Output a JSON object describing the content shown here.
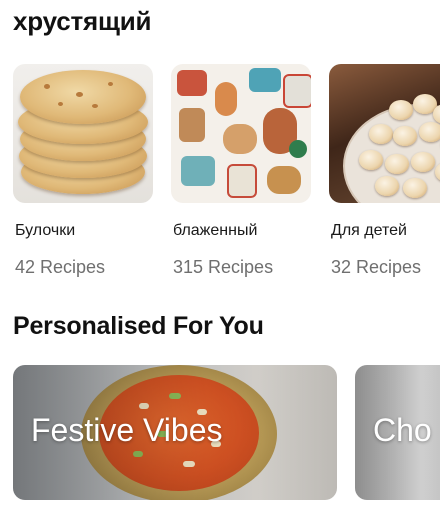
{
  "sections": {
    "top_title": "хрустящий",
    "personalised_title": "Personalised For You"
  },
  "categories": [
    {
      "title": "Булочки",
      "count": "42 Recipes",
      "image": "stacked-cookies-photo"
    },
    {
      "title": "блаженный",
      "count": "315 Recipes",
      "image": "gingerbread-cookies-photo"
    },
    {
      "title": "Для детей",
      "count": "32 Recipes",
      "image": "cookie-plate-photo"
    }
  ],
  "personalised": [
    {
      "label": "Festive Vibes",
      "image": "halwa-bowl-photo"
    },
    {
      "label": "Cho",
      "image": "chocolate-photo"
    }
  ],
  "colors": {
    "background": "#ffffff",
    "title_text": "#111111",
    "muted_text": "#6f6f6f",
    "overlay_text": "#ffffff"
  }
}
